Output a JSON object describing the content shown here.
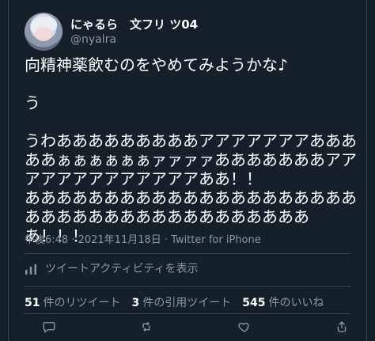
{
  "user": {
    "display_name": "にゃるら　文フリ ツ04",
    "handle": "@nyalra"
  },
  "tweet": {
    "text": "向精神薬飲むのをやめてみようかな♪\n\nう\n\nうわあああああああああアアアアアアアあああああぁぁぁぁぁぁァァァァあああああああアアアアアアアアアアアアアああ！！\nああああああああああああああああああああああああああああああああああああああああ！！！"
  },
  "meta": {
    "text": "午後6:48 · 2021年11月18日 · Twitter for iPhone"
  },
  "activity": {
    "label": "ツイートアクティビティを表示"
  },
  "stats": {
    "retweets_count": "51",
    "retweets_label": "件のリツイート",
    "quotes_count": "3",
    "quotes_label": "件の引用ツイート",
    "likes_count": "545",
    "likes_label": "件のいいね"
  },
  "icons": {
    "activity": "bar-chart-icon",
    "reply": "reply-icon",
    "retweet": "retweet-icon",
    "like": "heart-icon",
    "share": "share-icon"
  },
  "colors": {
    "background": "#15202b",
    "text": "#ffffff",
    "muted": "#8899a6",
    "border": "#38444d"
  }
}
